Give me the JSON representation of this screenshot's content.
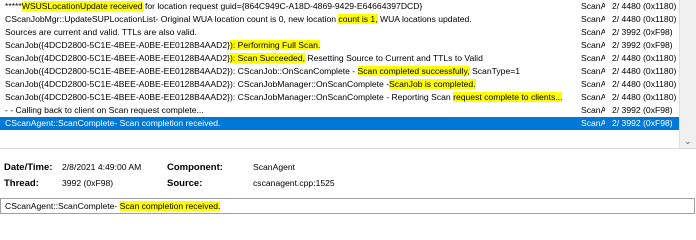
{
  "log": {
    "rows": [
      {
        "segments": [
          {
            "text": "*****",
            "hl": false
          },
          {
            "text": "WSUSLocationUpdate received",
            "hl": true
          },
          {
            "text": " for location request guid={864C949C-A18D-4869-9429-E64664397DCD}",
            "hl": false
          }
        ],
        "component": "ScanA",
        "thread": "2/ 4480 (0x1180)",
        "selected": false
      },
      {
        "segments": [
          {
            "text": "CScanJobMgr::UpdateSUPLocationList- Original WUA location count is 0, new location ",
            "hl": false
          },
          {
            "text": "count is 1,",
            "hl": true
          },
          {
            "text": " WUA locations updated.",
            "hl": false
          }
        ],
        "component": "ScanA",
        "thread": "2/ 4480 (0x1180)",
        "selected": false
      },
      {
        "segments": [
          {
            "text": "Sources are current and valid. TTLs are also valid.",
            "hl": false
          }
        ],
        "component": "ScanA",
        "thread": "2/ 3992 (0xF98)",
        "selected": false
      },
      {
        "segments": [
          {
            "text": "ScanJob({4DCD2800-5C1E-4BEE-A0BE-EE0128B4AAD2}",
            "hl": false
          },
          {
            "text": "): Performing Full Scan.",
            "hl": true
          }
        ],
        "component": "ScanA",
        "thread": "2/ 3992 (0xF98)",
        "selected": false
      },
      {
        "segments": [
          {
            "text": "ScanJob({4DCD2800-5C1E-4BEE-A0BE-EE0128B4AAD2}",
            "hl": false
          },
          {
            "text": "): Scan Succeeded,",
            "hl": true
          },
          {
            "text": " Resetting Source to Current and TTLs to Valid",
            "hl": false
          }
        ],
        "component": "ScanA",
        "thread": "2/ 4480 (0x1180)",
        "selected": false
      },
      {
        "segments": [
          {
            "text": "ScanJob({4DCD2800-5C1E-4BEE-A0BE-EE0128B4AAD2}): CScanJob::OnScanComplete - ",
            "hl": false
          },
          {
            "text": "Scan completed successfully,",
            "hl": true
          },
          {
            "text": " ScanType=1",
            "hl": false
          }
        ],
        "component": "ScanA",
        "thread": "2/ 4480 (0x1180)",
        "selected": false
      },
      {
        "segments": [
          {
            "text": "ScanJob({4DCD2800-5C1E-4BEE-A0BE-EE0128B4AAD2}): CScanJobManager::OnScanComplete -",
            "hl": false
          },
          {
            "text": "ScanJob is completed.",
            "hl": true
          }
        ],
        "component": "ScanA",
        "thread": "2/ 4480 (0x1180)",
        "selected": false
      },
      {
        "segments": [
          {
            "text": "ScanJob({4DCD2800-5C1E-4BEE-A0BE-EE0128B4AAD2}): CScanJobManager::OnScanComplete - Reporting Scan ",
            "hl": false
          },
          {
            "text": "request complete to clients...",
            "hl": true
          }
        ],
        "component": "ScanA",
        "thread": "2/ 4480 (0x1180)",
        "selected": false
      },
      {
        "segments": [
          {
            "text": "- - Calling back to client on Scan request complete...",
            "hl": false
          }
        ],
        "component": "ScanA",
        "thread": "2/ 3992 (0xF98)",
        "selected": false
      },
      {
        "segments": [
          {
            "text": "CScanAgent::ScanComplete- Scan completion received.",
            "hl": false
          }
        ],
        "component": "ScanA",
        "thread": "2/ 3992 (0xF98)",
        "selected": true
      }
    ]
  },
  "details": {
    "date_label": "Date/Time:",
    "date_value": "2/8/2021 4:49:00 AM",
    "component_label": "Component:",
    "component_value": "ScanAgent",
    "thread_label": "Thread:",
    "thread_value": "3992 (0xF98)",
    "source_label": "Source:",
    "source_value": "cscanagent.cpp:1525"
  },
  "message": {
    "prefix": "CScanAgent::ScanComplete- ",
    "highlight": "Scan completion received."
  },
  "colors": {
    "highlight": "#ffff00",
    "selection": "#0078d7"
  },
  "icons": {
    "scroll_down": "chevron-down-icon"
  }
}
